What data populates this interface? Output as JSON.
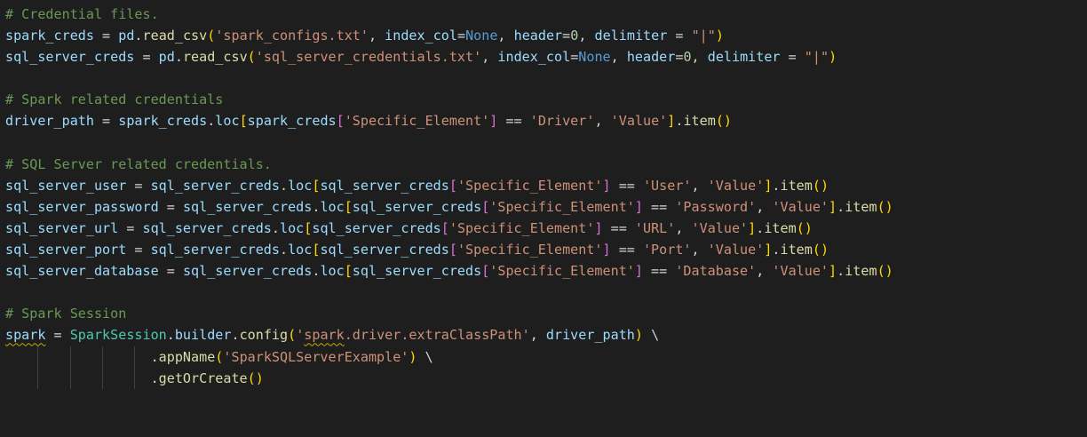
{
  "editor": {
    "lines": [
      {
        "tokens": [
          {
            "t": "# Credential files.",
            "c": "comment"
          }
        ]
      },
      {
        "tokens": [
          {
            "t": "spark_creds",
            "c": "var"
          },
          {
            "t": " = ",
            "c": "op"
          },
          {
            "t": "pd",
            "c": "var"
          },
          {
            "t": ".",
            "c": "op"
          },
          {
            "t": "read_csv",
            "c": "fn"
          },
          {
            "t": "(",
            "c": "b1"
          },
          {
            "t": "'spark_configs.txt'",
            "c": "str"
          },
          {
            "t": ", ",
            "c": "op"
          },
          {
            "t": "index_col",
            "c": "var"
          },
          {
            "t": "=",
            "c": "op"
          },
          {
            "t": "None",
            "c": "kw"
          },
          {
            "t": ", ",
            "c": "op"
          },
          {
            "t": "header",
            "c": "var"
          },
          {
            "t": "=",
            "c": "op"
          },
          {
            "t": "0",
            "c": "num"
          },
          {
            "t": ", ",
            "c": "op"
          },
          {
            "t": "delimiter",
            "c": "var"
          },
          {
            "t": " = ",
            "c": "op"
          },
          {
            "t": "\"|\"",
            "c": "str"
          },
          {
            "t": ")",
            "c": "b1"
          }
        ]
      },
      {
        "tokens": [
          {
            "t": "sql_server_creds",
            "c": "var"
          },
          {
            "t": " = ",
            "c": "op"
          },
          {
            "t": "pd",
            "c": "var"
          },
          {
            "t": ".",
            "c": "op"
          },
          {
            "t": "read_csv",
            "c": "fn"
          },
          {
            "t": "(",
            "c": "b1"
          },
          {
            "t": "'sql_server_credentials.txt'",
            "c": "str"
          },
          {
            "t": ", ",
            "c": "op"
          },
          {
            "t": "index_col",
            "c": "var"
          },
          {
            "t": "=",
            "c": "op"
          },
          {
            "t": "None",
            "c": "kw"
          },
          {
            "t": ", ",
            "c": "op"
          },
          {
            "t": "header",
            "c": "var"
          },
          {
            "t": "=",
            "c": "op"
          },
          {
            "t": "0",
            "c": "num"
          },
          {
            "t": ", ",
            "c": "op"
          },
          {
            "t": "delimiter",
            "c": "var"
          },
          {
            "t": " = ",
            "c": "op"
          },
          {
            "t": "\"|\"",
            "c": "str"
          },
          {
            "t": ")",
            "c": "b1"
          }
        ]
      },
      {
        "tokens": []
      },
      {
        "tokens": [
          {
            "t": "# Spark related credentials",
            "c": "comment"
          }
        ]
      },
      {
        "tokens": [
          {
            "t": "driver_path",
            "c": "var"
          },
          {
            "t": " = ",
            "c": "op"
          },
          {
            "t": "spark_creds",
            "c": "var"
          },
          {
            "t": ".",
            "c": "op"
          },
          {
            "t": "loc",
            "c": "var"
          },
          {
            "t": "[",
            "c": "b1"
          },
          {
            "t": "spark_creds",
            "c": "var"
          },
          {
            "t": "[",
            "c": "b2"
          },
          {
            "t": "'Specific_Element'",
            "c": "str"
          },
          {
            "t": "]",
            "c": "b2"
          },
          {
            "t": " == ",
            "c": "op"
          },
          {
            "t": "'Driver'",
            "c": "str"
          },
          {
            "t": ", ",
            "c": "op"
          },
          {
            "t": "'Value'",
            "c": "str"
          },
          {
            "t": "]",
            "c": "b1"
          },
          {
            "t": ".",
            "c": "op"
          },
          {
            "t": "item",
            "c": "fn"
          },
          {
            "t": "()",
            "c": "b1"
          }
        ]
      },
      {
        "tokens": []
      },
      {
        "tokens": [
          {
            "t": "# SQL Server related credentials.",
            "c": "comment"
          }
        ]
      },
      {
        "tokens": [
          {
            "t": "sql_server_user",
            "c": "var"
          },
          {
            "t": " = ",
            "c": "op"
          },
          {
            "t": "sql_server_creds",
            "c": "var"
          },
          {
            "t": ".",
            "c": "op"
          },
          {
            "t": "loc",
            "c": "var"
          },
          {
            "t": "[",
            "c": "b1"
          },
          {
            "t": "sql_server_creds",
            "c": "var"
          },
          {
            "t": "[",
            "c": "b2"
          },
          {
            "t": "'Specific_Element'",
            "c": "str"
          },
          {
            "t": "]",
            "c": "b2"
          },
          {
            "t": " == ",
            "c": "op"
          },
          {
            "t": "'User'",
            "c": "str"
          },
          {
            "t": ", ",
            "c": "op"
          },
          {
            "t": "'Value'",
            "c": "str"
          },
          {
            "t": "]",
            "c": "b1"
          },
          {
            "t": ".",
            "c": "op"
          },
          {
            "t": "item",
            "c": "fn"
          },
          {
            "t": "()",
            "c": "b1"
          }
        ]
      },
      {
        "tokens": [
          {
            "t": "sql_server_password",
            "c": "var"
          },
          {
            "t": " = ",
            "c": "op"
          },
          {
            "t": "sql_server_creds",
            "c": "var"
          },
          {
            "t": ".",
            "c": "op"
          },
          {
            "t": "loc",
            "c": "var"
          },
          {
            "t": "[",
            "c": "b1"
          },
          {
            "t": "sql_server_creds",
            "c": "var"
          },
          {
            "t": "[",
            "c": "b2"
          },
          {
            "t": "'Specific_Element'",
            "c": "str"
          },
          {
            "t": "]",
            "c": "b2"
          },
          {
            "t": " == ",
            "c": "op"
          },
          {
            "t": "'Password'",
            "c": "str"
          },
          {
            "t": ", ",
            "c": "op"
          },
          {
            "t": "'Value'",
            "c": "str"
          },
          {
            "t": "]",
            "c": "b1"
          },
          {
            "t": ".",
            "c": "op"
          },
          {
            "t": "item",
            "c": "fn"
          },
          {
            "t": "()",
            "c": "b1"
          }
        ]
      },
      {
        "tokens": [
          {
            "t": "sql_server_url",
            "c": "var"
          },
          {
            "t": " = ",
            "c": "op"
          },
          {
            "t": "sql_server_creds",
            "c": "var"
          },
          {
            "t": ".",
            "c": "op"
          },
          {
            "t": "loc",
            "c": "var"
          },
          {
            "t": "[",
            "c": "b1"
          },
          {
            "t": "sql_server_creds",
            "c": "var"
          },
          {
            "t": "[",
            "c": "b2"
          },
          {
            "t": "'Specific_Element'",
            "c": "str"
          },
          {
            "t": "]",
            "c": "b2"
          },
          {
            "t": " == ",
            "c": "op"
          },
          {
            "t": "'URL'",
            "c": "str"
          },
          {
            "t": ", ",
            "c": "op"
          },
          {
            "t": "'Value'",
            "c": "str"
          },
          {
            "t": "]",
            "c": "b1"
          },
          {
            "t": ".",
            "c": "op"
          },
          {
            "t": "item",
            "c": "fn"
          },
          {
            "t": "()",
            "c": "b1"
          }
        ]
      },
      {
        "tokens": [
          {
            "t": "sql_server_port",
            "c": "var"
          },
          {
            "t": " = ",
            "c": "op"
          },
          {
            "t": "sql_server_creds",
            "c": "var"
          },
          {
            "t": ".",
            "c": "op"
          },
          {
            "t": "loc",
            "c": "var"
          },
          {
            "t": "[",
            "c": "b1"
          },
          {
            "t": "sql_server_creds",
            "c": "var"
          },
          {
            "t": "[",
            "c": "b2"
          },
          {
            "t": "'Specific_Element'",
            "c": "str"
          },
          {
            "t": "]",
            "c": "b2"
          },
          {
            "t": " == ",
            "c": "op"
          },
          {
            "t": "'Port'",
            "c": "str"
          },
          {
            "t": ", ",
            "c": "op"
          },
          {
            "t": "'Value'",
            "c": "str"
          },
          {
            "t": "]",
            "c": "b1"
          },
          {
            "t": ".",
            "c": "op"
          },
          {
            "t": "item",
            "c": "fn"
          },
          {
            "t": "()",
            "c": "b1"
          }
        ]
      },
      {
        "tokens": [
          {
            "t": "sql_server_database",
            "c": "var"
          },
          {
            "t": " = ",
            "c": "op"
          },
          {
            "t": "sql_server_creds",
            "c": "var"
          },
          {
            "t": ".",
            "c": "op"
          },
          {
            "t": "loc",
            "c": "var"
          },
          {
            "t": "[",
            "c": "b1"
          },
          {
            "t": "sql_server_creds",
            "c": "var"
          },
          {
            "t": "[",
            "c": "b2"
          },
          {
            "t": "'Specific_Element'",
            "c": "str"
          },
          {
            "t": "]",
            "c": "b2"
          },
          {
            "t": " == ",
            "c": "op"
          },
          {
            "t": "'Database'",
            "c": "str"
          },
          {
            "t": ", ",
            "c": "op"
          },
          {
            "t": "'Value'",
            "c": "str"
          },
          {
            "t": "]",
            "c": "b1"
          },
          {
            "t": ".",
            "c": "op"
          },
          {
            "t": "item",
            "c": "fn"
          },
          {
            "t": "()",
            "c": "b1"
          }
        ]
      },
      {
        "tokens": []
      },
      {
        "tokens": [
          {
            "t": "# Spark Session",
            "c": "comment"
          }
        ]
      },
      {
        "tokens": [
          {
            "t": "spark",
            "c": "var",
            "squiggle": true
          },
          {
            "t": " = ",
            "c": "op"
          },
          {
            "t": "SparkSession",
            "c": "cls"
          },
          {
            "t": ".",
            "c": "op"
          },
          {
            "t": "builder",
            "c": "var"
          },
          {
            "t": ".",
            "c": "op"
          },
          {
            "t": "config",
            "c": "fn"
          },
          {
            "t": "(",
            "c": "b1"
          },
          {
            "t": "'",
            "c": "str"
          },
          {
            "t": "spark",
            "c": "str",
            "squiggle": true
          },
          {
            "t": ".driver.extraClassPath'",
            "c": "str"
          },
          {
            "t": ", ",
            "c": "op"
          },
          {
            "t": "driver_path",
            "c": "var"
          },
          {
            "t": ")",
            "c": "b1"
          },
          {
            "t": " \\",
            "c": "op"
          }
        ]
      },
      {
        "tokens": [
          {
            "t": "                  ",
            "c": "op"
          },
          {
            "t": ".",
            "c": "op"
          },
          {
            "t": "appName",
            "c": "fn"
          },
          {
            "t": "(",
            "c": "b1"
          },
          {
            "t": "'SparkSQLServerExample'",
            "c": "str"
          },
          {
            "t": ")",
            "c": "b1"
          },
          {
            "t": " \\",
            "c": "op"
          }
        ]
      },
      {
        "tokens": [
          {
            "t": "                  ",
            "c": "op"
          },
          {
            "t": ".",
            "c": "op"
          },
          {
            "t": "getOrCreate",
            "c": "fn"
          },
          {
            "t": "()",
            "c": "b1"
          }
        ]
      }
    ]
  },
  "colors": {
    "background": "#1e1e1e",
    "comment": "#6a9955",
    "variable": "#9cdcfe",
    "function": "#dcdcaa",
    "string": "#ce9178",
    "keyword": "#569cd6",
    "number": "#b5cea8",
    "class": "#4ec9b0",
    "bracket_level_1": "#ffd700",
    "bracket_level_2": "#da70d6"
  }
}
